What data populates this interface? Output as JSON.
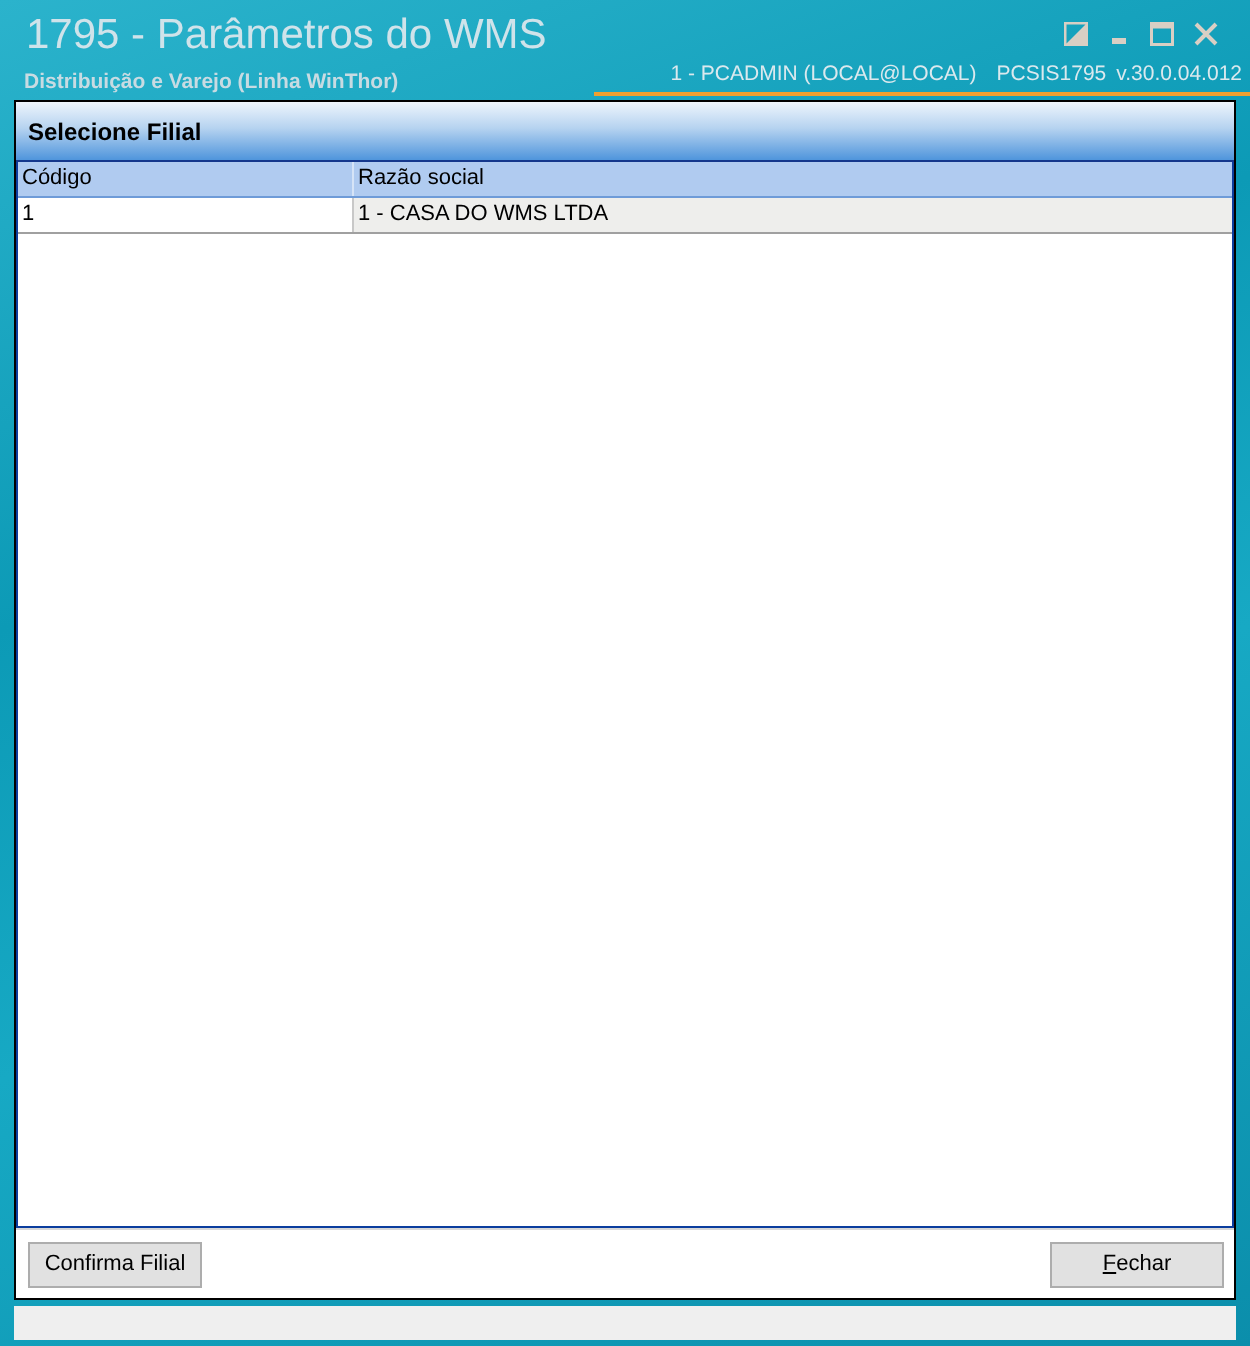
{
  "window": {
    "title": "1795 - Parâmetros do WMS",
    "subtitle": "Distribuição e Varejo (Linha WinThor)",
    "user": "1 - PCADMIN (LOCAL@LOCAL)",
    "program": "PCSIS1795",
    "version": "v.30.0.04.012"
  },
  "panel": {
    "title": "Selecione Filial"
  },
  "table": {
    "columns": [
      "Código",
      "Razão social"
    ],
    "rows": [
      {
        "cells": [
          "1",
          "1 - CASA DO WMS LTDA"
        ],
        "selected": true
      }
    ]
  },
  "buttons": [
    {
      "label": "Confirma Filial",
      "mnemonic": false
    },
    {
      "label": "Fechar",
      "mnemonic": true
    }
  ]
}
